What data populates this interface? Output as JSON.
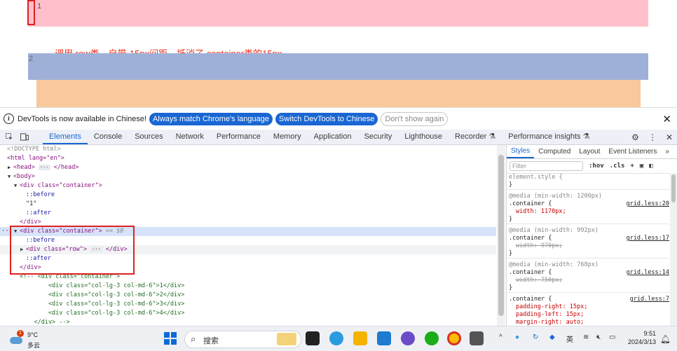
{
  "viewport": {
    "box1_label": "1",
    "box2_label": "2",
    "annotation": "调用.row类，自带-15px间距，抵消了.container类的15px"
  },
  "infobar": {
    "message": "DevTools is now available in Chinese!",
    "btn_match": "Always match Chrome's language",
    "btn_switch": "Switch DevTools to Chinese",
    "btn_dismiss": "Don't show again"
  },
  "toolbar": {
    "tabs": [
      "Elements",
      "Console",
      "Sources",
      "Network",
      "Performance",
      "Memory",
      "Application",
      "Security",
      "Lighthouse",
      "Recorder",
      "Performance insights"
    ],
    "active_tab": "Elements"
  },
  "elements": {
    "doctype": "<!DOCTYPE html>",
    "html_open": "<html lang=\"en\">",
    "head": "<head>",
    "head_close": "</head>",
    "body": "<body>",
    "div_container_1": "<div class=\"container\">",
    "before": "::before",
    "text_1": "\"1\"",
    "after": "::after",
    "div_close": "</div>",
    "selected_div": "<div class=\"container\">",
    "selected_suffix": " == $0",
    "row_div": "<div class=\"row\">",
    "row_close": "</div>",
    "comment_lines": [
      "<!-- <div class=\"container\">",
      "        <div class=\"col-lg-3 col-md-6\">1</div>",
      "        <div class=\"col-lg-3 col-md-6\">2</div>",
      "        <div class=\"col-lg-3 col-md-6\">3</div>",
      "        <div class=\"col-lg-3 col-md-6\">4</div>",
      "    </div> -->"
    ]
  },
  "styles": {
    "tabs": [
      "Styles",
      "Computed",
      "Layout",
      "Event Listeners"
    ],
    "active_tab": "Styles",
    "filter_placeholder": "Filter",
    "hov": ":hov",
    "cls": ".cls",
    "element_style": "element.style {",
    "close_brace": "}",
    "rules": [
      {
        "media": "@media (min-width: 1200px)",
        "selector": ".container {",
        "source": "grid.less:20",
        "prop": "width: 1170px;",
        "struck": false
      },
      {
        "media": "@media (min-width: 992px)",
        "selector": ".container {",
        "source": "grid.less:17",
        "prop": "width: 970px;",
        "struck": true
      },
      {
        "media": "@media (min-width: 768px)",
        "selector": ".container {",
        "source": "grid.less:14",
        "prop": "width: 750px;",
        "struck": true
      }
    ],
    "last_rule": {
      "selector": ".container {",
      "source": "grid.less:7",
      "props": [
        "padding-right: 15px;",
        "padding-left: 15px;",
        "margin-right: auto;"
      ]
    }
  },
  "taskbar": {
    "weather_badge": "1",
    "temperature": "9°C",
    "condition": "多云",
    "search_label": "搜索",
    "lang": "英",
    "time": "9:51",
    "date": "2024/3/13"
  }
}
